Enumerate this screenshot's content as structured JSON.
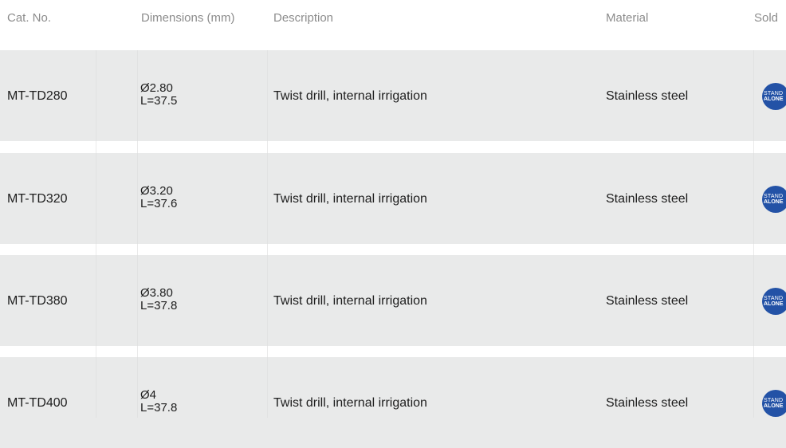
{
  "table": {
    "headers": {
      "cat_no": "Cat. No.",
      "dimensions": "Dimensions (mm)",
      "description": "Description",
      "material": "Material",
      "sold": "Sold"
    },
    "rows": [
      {
        "cat_no": "MT-TD280",
        "diameter": "Ø2.80",
        "length": "L=37.5",
        "description": "Twist drill, internal irrigation",
        "material": "Stainless steel",
        "badge_top": "STAND",
        "badge_bottom": "ALONE"
      },
      {
        "cat_no": "MT-TD320",
        "diameter": "Ø3.20",
        "length": "L=37.6",
        "description": "Twist drill, internal irrigation",
        "material": "Stainless steel",
        "badge_top": "STAND",
        "badge_bottom": "ALONE"
      },
      {
        "cat_no": "MT-TD380",
        "diameter": "Ø3.80",
        "length": "L=37.8",
        "description": "Twist drill, internal irrigation",
        "material": "Stainless steel",
        "badge_top": "STAND",
        "badge_bottom": "ALONE"
      },
      {
        "cat_no": "MT-TD400",
        "diameter": "Ø4",
        "length": "L=37.8",
        "description": "Twist drill, internal irrigation",
        "material": "Stainless steel",
        "badge_top": "STAND",
        "badge_bottom": "ALONE"
      }
    ]
  },
  "colors": {
    "row_background": "#e9eaea",
    "badge": "#2352a6",
    "header_text": "#8c8c8c"
  }
}
